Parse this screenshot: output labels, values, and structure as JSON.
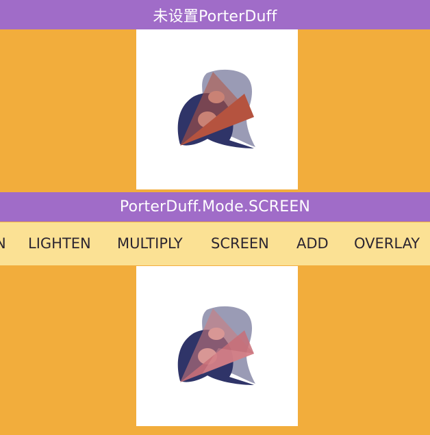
{
  "header": {
    "title": "未设置PorterDuff"
  },
  "mode_bar": {
    "title": "PorterDuff.Mode.SCREEN"
  },
  "tabs": [
    {
      "label": "N"
    },
    {
      "label": "LIGHTEN"
    },
    {
      "label": "MULTIPLY"
    },
    {
      "label": "SCREEN"
    },
    {
      "label": "ADD"
    },
    {
      "label": "OVERLAY"
    }
  ],
  "selected_tab": "SCREEN",
  "colors": {
    "background": "#F2AD3C",
    "title_bar": "#A06CC8",
    "tab_strip": "#FBE194",
    "panel": "#FFFFFF",
    "shape_dark": "#2F3468",
    "shape_light": "#9A9BB5",
    "triangle": "#B5533F"
  }
}
